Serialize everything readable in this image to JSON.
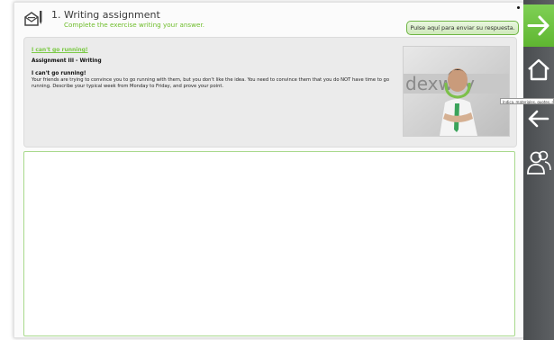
{
  "header": {
    "title": "1. Writing assignment",
    "subtitle": "Complete the exercise writing your answer.",
    "submit_label": "Pulse aquí para enviar su respuesta."
  },
  "assignment": {
    "link_text": "I can't go running!",
    "title": "Assignment III - Writing",
    "heading": "I can't go running!",
    "body": "Your friends are trying to convince you to go running with them, but you don't like the idea. You need to convince them that you do NOT have time to go running. Describe your typical week from Monday to Friday, and prove your point.",
    "photo_text": "dexway"
  },
  "answer": {
    "value": ""
  },
  "sidebar": {
    "tooltip": "Indica, materiales, quotes, rules..."
  },
  "colors": {
    "accent_green": "#6ebd2a",
    "sidebar_dark": "#4a4d50"
  }
}
